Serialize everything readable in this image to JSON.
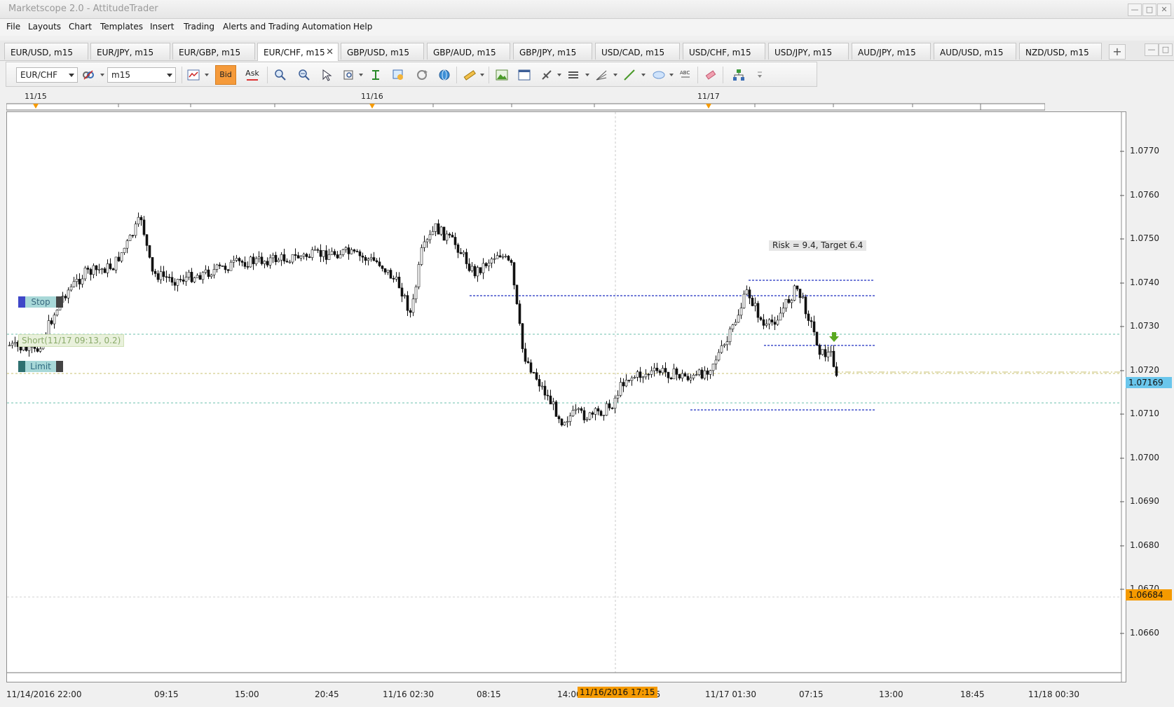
{
  "window": {
    "title": "Marketscope 2.0 - AttitudeTrader"
  },
  "menu": [
    "File",
    "Layouts",
    "Chart",
    "Templates",
    "Insert",
    "Trading",
    "Alerts and Trading Automation",
    "Help"
  ],
  "tabs": [
    "EUR/USD, m15",
    "EUR/JPY, m15",
    "EUR/GBP, m15",
    "EUR/CHF, m15",
    "GBP/USD, m15",
    "GBP/AUD, m15",
    "GBP/JPY, m15",
    "USD/CAD, m15",
    "USD/CHF, m15",
    "USD/JPY, m15",
    "AUD/JPY, m15",
    "AUD/USD, m15",
    "NZD/USD, m15"
  ],
  "active_tab": "EUR/CHF, m15",
  "toolbar": {
    "instrument": "EUR/CHF",
    "timeframe": "m15",
    "bid_label": "Bid",
    "ask_label": "Ask"
  },
  "date_markers": [
    "11/15",
    "11/16",
    "11/17"
  ],
  "chart": {
    "y_labels": [
      "1.0770",
      "1.0760",
      "1.0750",
      "1.0740",
      "1.0730",
      "1.0720",
      "1.0710",
      "1.0700",
      "1.0690",
      "1.0680",
      "1.0670",
      "1.0660"
    ],
    "x_labels": [
      "11/14/2016 22:00",
      "09:15",
      "15:00",
      "20:45",
      "11/16 02:30",
      "08:15",
      "14:00",
      "45",
      "11/17 01:30",
      "07:15",
      "13:00",
      "18:45",
      "11/18 00:30"
    ],
    "cursor_time": "11/16/2016 17:15",
    "current_price": "1.07169",
    "cursor_price": "1.06684",
    "stop_label": "Stop",
    "limit_label": "Limit",
    "short_label": "Short(11/17 09:13, 0.2)",
    "risk_label": "Risk = 9.4, Target 6.4"
  },
  "colors": {
    "accent": "#f59a3a",
    "current_price_bg": "#6ac6ec",
    "cursor_price_bg": "#f59a00",
    "level_line": "#1f2fc0",
    "stop_line": "#6bbfae"
  }
}
